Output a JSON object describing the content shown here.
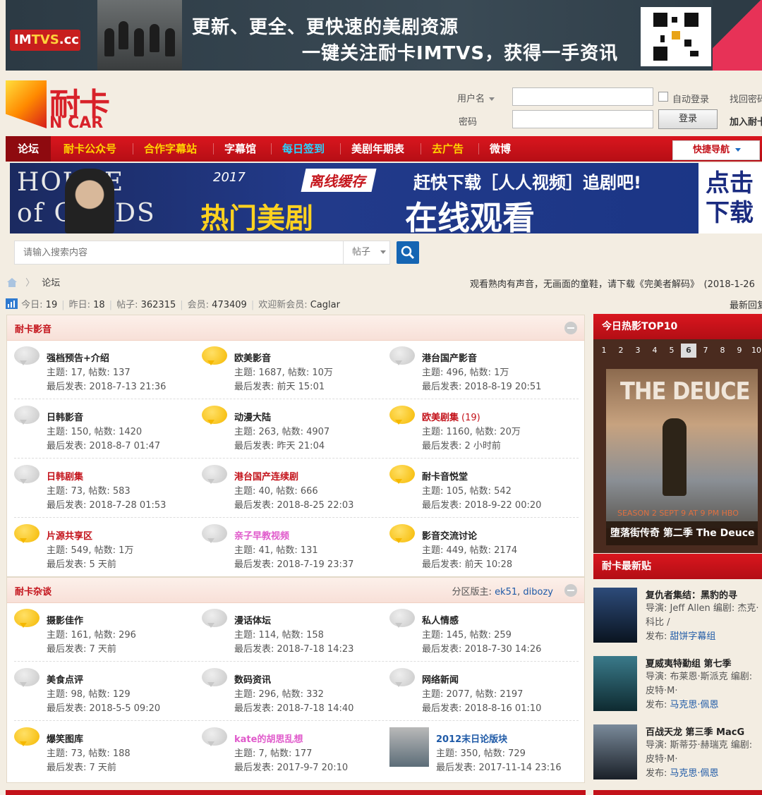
{
  "top_banner": {
    "brand": "IMTVS.cc",
    "line1": "更新、更全、更快速的美剧资源",
    "line2": "一键关注耐卡IMTVS，获得一手资讯"
  },
  "logo": {
    "cn": "耐卡",
    "en": "N CAR"
  },
  "login": {
    "username_label": "用户名",
    "password_label": "密码",
    "auto_login": "自动登录",
    "login_button": "登录",
    "find_password": "找回密码",
    "join": "加入耐卡"
  },
  "nav": {
    "items": [
      {
        "label": "论坛",
        "color": "#ffffff"
      },
      {
        "label": "耐卡公众号",
        "color": "#ffd200"
      },
      {
        "label": "合作字幕站",
        "color": "#ffd200"
      },
      {
        "label": "字幕馆",
        "color": "#ffffff"
      },
      {
        "label": "每日签到",
        "color": "#29d3ff"
      },
      {
        "label": "美剧年期表",
        "color": "#ffffff"
      },
      {
        "label": "去广告",
        "color": "#ffd200"
      },
      {
        "label": "微博",
        "color": "#ffffff"
      }
    ],
    "quick_nav": "快捷导航"
  },
  "promo": {
    "show": "HOUSE of CARDS",
    "year": "2017",
    "tag": "离线缓存",
    "chase": "赶快下载［人人视频］追剧吧!",
    "hot": "热门美剧",
    "online": "在线观看",
    "click": "点击下载"
  },
  "search": {
    "placeholder": "请输入搜索内容",
    "type": "帖子"
  },
  "crumb": {
    "label": "论坛"
  },
  "notice": "观看熟肉有声音，无画面的童鞋，请下载《完美者解码》　(2018-1-26",
  "stats": {
    "today_label": "今日:",
    "today": "19",
    "yesterday_label": "昨日:",
    "yesterday": "18",
    "posts_label": "帖子:",
    "posts": "362315",
    "members_label": "会员:",
    "members": "473409",
    "newmember_label": "欢迎新会员:",
    "newmember": "Caglar",
    "latest": "最新回复"
  },
  "sections": [
    {
      "title": "耐卡影音",
      "forums": [
        {
          "name": "强档预告+介绍",
          "topics": "主题: 17, 帖数: 137",
          "last": "最后发表: 2018-7-13 21:36",
          "new": false,
          "color": "#222"
        },
        {
          "name": "欧美影音",
          "topics": "主题: 1687, 帖数: 10万",
          "last": "最后发表: 前天 15:01",
          "new": true,
          "color": "#222"
        },
        {
          "name": "港台国产影音",
          "topics": "主题: 496, 帖数: 1万",
          "last": "最后发表: 2018-8-19 20:51",
          "new": false,
          "color": "#222"
        },
        {
          "name": "日韩影音",
          "topics": "主题: 150, 帖数: 1420",
          "last": "最后发表: 2018-8-7 01:47",
          "new": false,
          "color": "#222"
        },
        {
          "name": "动漫大陆",
          "topics": "主题: 263, 帖数: 4907",
          "last": "最后发表: 昨天 21:04",
          "new": true,
          "color": "#222"
        },
        {
          "name": "欧美剧集",
          "today": "(19)",
          "topics": "主题: 1160, 帖数: 20万",
          "last": "最后发表: 2 小时前",
          "new": true,
          "color": "#c3121a"
        },
        {
          "name": "日韩剧集",
          "topics": "主题: 73, 帖数: 583",
          "last": "最后发表: 2018-7-28 01:53",
          "new": false,
          "color": "#c3121a"
        },
        {
          "name": "港台国产连续剧",
          "topics": "主题: 40, 帖数: 666",
          "last": "最后发表: 2018-8-25 22:03",
          "new": false,
          "color": "#c3121a"
        },
        {
          "name": "耐卡音悦堂",
          "topics": "主题: 105, 帖数: 542",
          "last": "最后发表: 2018-9-22 00:20",
          "new": true,
          "color": "#222"
        },
        {
          "name": "片源共享区",
          "topics": "主题: 549, 帖数: 1万",
          "last": "最后发表: 5 天前",
          "new": true,
          "color": "#c3121a"
        },
        {
          "name": "亲子早教视频",
          "topics": "主题: 41, 帖数: 131",
          "last": "最后发表: 2018-7-19 23:37",
          "new": false,
          "color": "#e05acb"
        },
        {
          "name": "影音交流讨论",
          "topics": "主题: 449, 帖数: 2174",
          "last": "最后发表: 前天 10:28",
          "new": true,
          "color": "#222"
        }
      ]
    },
    {
      "title": "耐卡杂谈",
      "mods_label": "分区版主:",
      "mods": [
        "ek51",
        "dibozy"
      ],
      "forums": [
        {
          "name": "摄影佳作",
          "topics": "主题: 161, 帖数: 296",
          "last": "最后发表: 7 天前",
          "new": true,
          "color": "#222"
        },
        {
          "name": "漫话体坛",
          "topics": "主题: 114, 帖数: 158",
          "last": "最后发表: 2018-7-18 14:23",
          "new": false,
          "color": "#222"
        },
        {
          "name": "私人情感",
          "topics": "主题: 145, 帖数: 259",
          "last": "最后发表: 2018-7-30 14:26",
          "new": false,
          "color": "#222"
        },
        {
          "name": "美食点评",
          "topics": "主题: 98, 帖数: 129",
          "last": "最后发表: 2018-5-5 09:20",
          "new": false,
          "color": "#222"
        },
        {
          "name": "数码资讯",
          "topics": "主题: 296, 帖数: 332",
          "last": "最后发表: 2018-7-18 14:40",
          "new": false,
          "color": "#222"
        },
        {
          "name": "网络新闻",
          "topics": "主题: 2077, 帖数: 2197",
          "last": "最后发表: 2018-8-16 01:10",
          "new": false,
          "color": "#222"
        },
        {
          "name": "爆笑图库",
          "topics": "主题: 73, 帖数: 188",
          "last": "最后发表: 7 天前",
          "new": true,
          "color": "#222"
        },
        {
          "name": "kate的胡思乱想",
          "topics": "主题: 7, 帖数: 177",
          "last": "最后发表: 2017-9-7 20:10",
          "new": false,
          "color": "#e05acb"
        },
        {
          "name": "2012末日论版块",
          "topics": "主题: 350, 帖数: 729",
          "last": "最后发表: 2017-11-14 23:16",
          "new": false,
          "color": "#1f5aa7",
          "thumb": true
        }
      ]
    }
  ],
  "sidebar": {
    "hot_title": "今日热影TOP10",
    "tabs": [
      "1",
      "2",
      "3",
      "4",
      "5",
      "6",
      "7",
      "8",
      "9",
      "10"
    ],
    "active_tab": "6",
    "poster_title": "THE DEUCE",
    "poster_season": "SEASON 2 SEPT 9 AT 9 PM HBO",
    "hot_caption": "堕落街传奇 第二季 The Deuce",
    "news_title": "耐卡最新贴",
    "news": [
      {
        "title": "复仇者集结：黑豹的寻",
        "desc": "导演: Jeff Allen 编剧: 杰克·科比 /",
        "pub_label": "发布:",
        "pub": "甜饼字幕组"
      },
      {
        "title": "夏威夷特勤组 第七季",
        "desc": "导演: 布莱恩·斯派克 编剧: 皮特·M·",
        "pub_label": "发布:",
        "pub": "马克思·佩恩"
      },
      {
        "title": "百战天龙 第三季 MacG",
        "desc": "导演: 斯蒂芬·赫瑞克 编剧: 皮特·M·",
        "pub_label": "发布:",
        "pub": "马克思·佩恩"
      }
    ]
  }
}
